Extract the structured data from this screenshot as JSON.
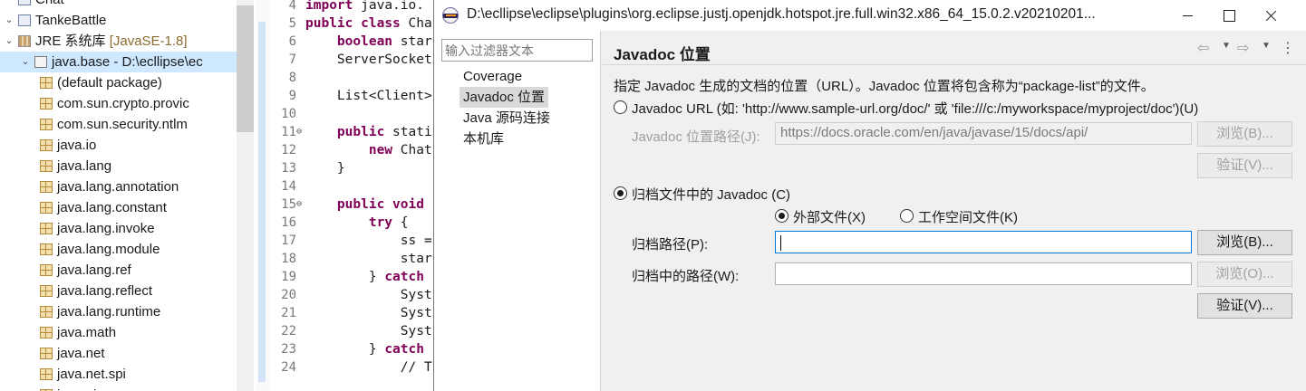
{
  "tree": {
    "rows": [
      {
        "label": "Chat",
        "deco": "",
        "kind": "project",
        "twisty": "",
        "indent": 0
      },
      {
        "label": "TankeBattle",
        "deco": "",
        "kind": "project",
        "twisty": "⌄",
        "indent": 0
      },
      {
        "label": "JRE 系统库 ",
        "deco": "[JavaSE-1.8]",
        "kind": "lib",
        "twisty": "⌄",
        "indent": 1
      },
      {
        "label": "java.base - D:\\ecllipse\\ec",
        "deco": "",
        "kind": "jar",
        "twisty": "⌄",
        "indent": 2
      },
      {
        "label": "(default package)",
        "deco": "",
        "kind": "package",
        "twisty": "",
        "indent": 3
      },
      {
        "label": "com.sun.crypto.provic",
        "deco": "",
        "kind": "package",
        "twisty": "",
        "indent": 3
      },
      {
        "label": "com.sun.security.ntlm",
        "deco": "",
        "kind": "package",
        "twisty": "",
        "indent": 3
      },
      {
        "label": "java.io",
        "deco": "",
        "kind": "package",
        "twisty": "",
        "indent": 3
      },
      {
        "label": "java.lang",
        "deco": "",
        "kind": "package",
        "twisty": "",
        "indent": 3
      },
      {
        "label": "java.lang.annotation",
        "deco": "",
        "kind": "package",
        "twisty": "",
        "indent": 3
      },
      {
        "label": "java.lang.constant",
        "deco": "",
        "kind": "package",
        "twisty": "",
        "indent": 3
      },
      {
        "label": "java.lang.invoke",
        "deco": "",
        "kind": "package",
        "twisty": "",
        "indent": 3
      },
      {
        "label": "java.lang.module",
        "deco": "",
        "kind": "package",
        "twisty": "",
        "indent": 3
      },
      {
        "label": "java.lang.ref",
        "deco": "",
        "kind": "package",
        "twisty": "",
        "indent": 3
      },
      {
        "label": "java.lang.reflect",
        "deco": "",
        "kind": "package",
        "twisty": "",
        "indent": 3
      },
      {
        "label": "java.lang.runtime",
        "deco": "",
        "kind": "package",
        "twisty": "",
        "indent": 3
      },
      {
        "label": "java.math",
        "deco": "",
        "kind": "package",
        "twisty": "",
        "indent": 3
      },
      {
        "label": "java.net",
        "deco": "",
        "kind": "package",
        "twisty": "",
        "indent": 3
      },
      {
        "label": "java.net.spi",
        "deco": "",
        "kind": "package",
        "twisty": "",
        "indent": 3
      },
      {
        "label": "java.nio",
        "deco": "",
        "kind": "package",
        "twisty": "",
        "indent": 3
      }
    ]
  },
  "editor": {
    "lines": [
      {
        "n": "4",
        "fold": "",
        "text": "import java.io."
      },
      {
        "n": "5",
        "fold": "",
        "text": "public class Cha"
      },
      {
        "n": "6",
        "fold": "",
        "text": "    boolean star"
      },
      {
        "n": "7",
        "fold": "",
        "text": "    ServerSocket"
      },
      {
        "n": "8",
        "fold": "",
        "text": ""
      },
      {
        "n": "9",
        "fold": "",
        "text": "    List<Client>"
      },
      {
        "n": "10",
        "fold": "",
        "text": ""
      },
      {
        "n": "11",
        "fold": "⊖",
        "text": "    public stati"
      },
      {
        "n": "12",
        "fold": "",
        "text": "        new Chat"
      },
      {
        "n": "13",
        "fold": "",
        "text": "    }"
      },
      {
        "n": "14",
        "fold": "",
        "text": ""
      },
      {
        "n": "15",
        "fold": "⊖",
        "text": "    public void "
      },
      {
        "n": "16",
        "fold": "",
        "text": "        try {"
      },
      {
        "n": "17",
        "fold": "",
        "text": "            ss ="
      },
      {
        "n": "18",
        "fold": "",
        "text": "            star"
      },
      {
        "n": "19",
        "fold": "",
        "text": "        } catch "
      },
      {
        "n": "20",
        "fold": "",
        "text": "            Syst"
      },
      {
        "n": "21",
        "fold": "",
        "text": "            Syst"
      },
      {
        "n": "22",
        "fold": "",
        "text": "            Syst"
      },
      {
        "n": "23",
        "fold": "",
        "text": "        } catch "
      },
      {
        "n": "24",
        "fold": "",
        "text": "            // T"
      }
    ],
    "keywords": [
      "import",
      "public",
      "class",
      "boolean",
      "new",
      "void",
      "try",
      "catch",
      "static"
    ]
  },
  "dialog": {
    "title": "D:\\ecllipse\\eclipse\\plugins\\org.eclipse.justj.openjdk.hotspot.jre.full.win32.x86_64_15.0.2.v20210201...",
    "filter_placeholder": "输入过滤器文本",
    "nav_items": [
      "Coverage",
      "Javadoc 位置",
      "Java 源码连接",
      "本机库"
    ],
    "selected_nav_index": 1,
    "panel_title": "Javadoc 位置",
    "description": "指定 Javadoc 生成的文档的位置（URL）。Javadoc 位置将包含称为“package-list”的文件。",
    "url_option": {
      "label": "Javadoc URL (如: 'http://www.sample-url.org/doc/' 或 'file:///c:/myworkspace/myproject/doc')(U)",
      "selected": false,
      "path_label": "Javadoc 位置路径(J):",
      "path_value": "https://docs.oracle.com/en/java/javase/15/docs/api/",
      "browse_label": "浏览(B)...",
      "validate_label": "验证(V)..."
    },
    "archive_option": {
      "label": "归档文件中的 Javadoc (C)",
      "selected": true,
      "external_label": "外部文件(X)",
      "external_selected": true,
      "workspace_label": "工作空间文件(K)",
      "workspace_selected": false,
      "archive_path_label": "归档路径(P):",
      "archive_path_value": "",
      "archive_browse_label": "浏览(B)...",
      "inner_path_label": "归档中的路径(W):",
      "inner_path_value": "",
      "inner_browse_label": "浏览(O)...",
      "validate_label": "验证(V)..."
    }
  }
}
